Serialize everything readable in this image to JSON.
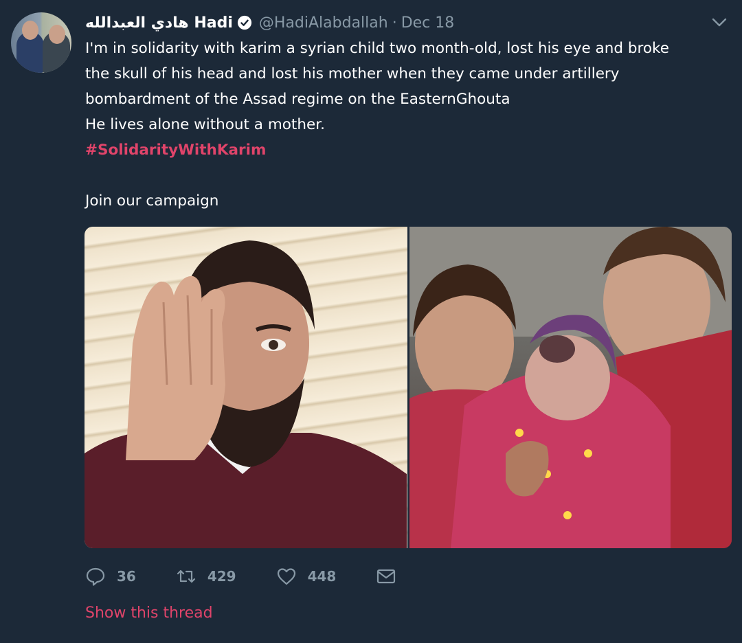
{
  "user": {
    "name": "هادي العبدالله Hadi",
    "handle": "@HadiAlabdallah",
    "date": "Dec 18"
  },
  "tweet": {
    "lines": [
      "I'm in solidarity with karim a syrian child two month-old, lost his eye and broke",
      "the skull of his head and lost his mother when they came under artillery",
      "bombardment of the Assad regime on the EasternGhouta",
      "He lives alone without a mother."
    ],
    "hashtag": "#SolidarityWithKarim",
    "cta": "Join our campaign"
  },
  "actions": {
    "replies": "36",
    "retweets": "429",
    "likes": "448"
  },
  "thread_link": "Show this thread",
  "colors": {
    "background": "#1c2938",
    "accent": "#e0446a",
    "muted": "#8899a6"
  },
  "icons": [
    "verified-badge-icon",
    "chevron-down-icon",
    "reply-icon",
    "retweet-icon",
    "like-icon",
    "direct-message-icon"
  ]
}
